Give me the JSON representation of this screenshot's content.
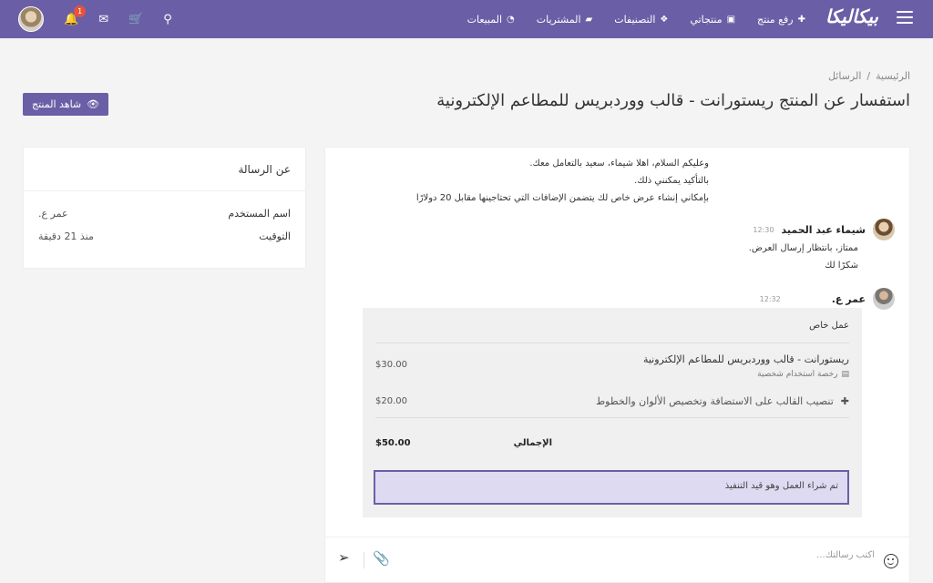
{
  "nav": {
    "logo": "بيكاليكا",
    "menu": [
      {
        "label": "رفع منتج",
        "icon": "plus-icon"
      },
      {
        "label": "منتجاتي",
        "icon": "briefcase-icon"
      },
      {
        "label": "التصنيفات",
        "icon": "cubes-icon"
      },
      {
        "label": "المشتريات",
        "icon": "folder-icon"
      },
      {
        "label": "المبيعات",
        "icon": "pie-chart-icon"
      }
    ],
    "notification_count": "1"
  },
  "breadcrumb": {
    "home": "الرئيسية",
    "separator": "/",
    "current": "الرسائل"
  },
  "page": {
    "title": "استفسار عن المنتج ريستورانت - قالب ووردبريس للمطاعم الإلكترونية",
    "view_product_label": "شاهد المنتج"
  },
  "about": {
    "title": "عن الرسالة",
    "rows": [
      {
        "label": "اسم المستخدم",
        "value": "عمر ع."
      },
      {
        "label": "التوقيت",
        "value": "منذ 21 دقيقة"
      }
    ]
  },
  "messages": {
    "block1": [
      "وعليكم السلام، اهلا شيماء، سعيد بالتعامل معك.",
      "بالتأكيد يمكنني ذلك.",
      "بإمكاني إنشاء عرض خاص لك يتضمن الإضافات التي تحتاجينها مقابل 20 دولارًا"
    ],
    "msg2": {
      "name": "شيماء عبد الحميد",
      "time": "12:30",
      "lines": [
        "ممتاز، بانتظار إرسال العرض.",
        "شكرًا لك"
      ]
    },
    "msg3": {
      "name": "عمر ع.",
      "time": "12:32"
    }
  },
  "offer": {
    "title": "عمل خاص",
    "item_title": "ريستورانت - قالب ووردبريس للمطاعم الإلكترونية",
    "item_sub": "رخصة استخدام شخصية",
    "item_price": "$30.00",
    "extra_label": "تنصيب القالب على الاستضافة وتخصيص الألوان والخطوط",
    "extra_price": "$20.00",
    "total_label": "الإجمالي",
    "total": "$50.00",
    "status": "تم شراء العمل وهو قيد التنفيذ"
  },
  "composer": {
    "placeholder": "اكتب رسالتك..."
  }
}
